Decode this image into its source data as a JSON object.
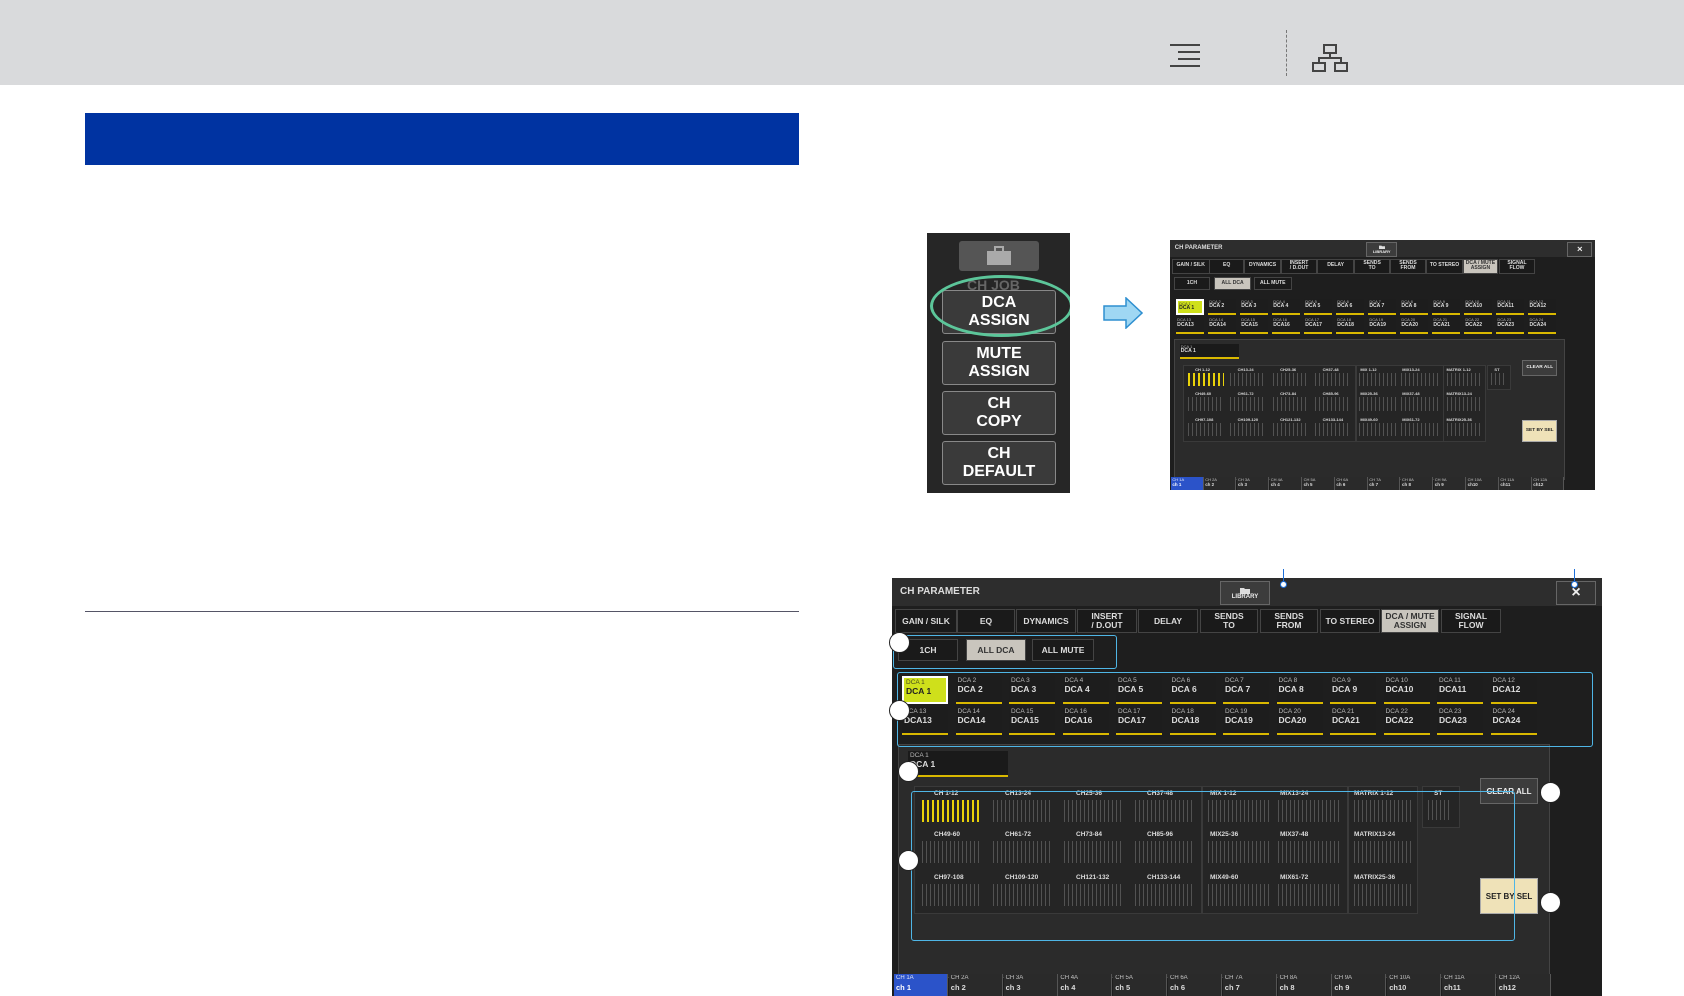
{
  "thumb_buttons": [
    {
      "label": "DCA\nASSIGN"
    },
    {
      "label": "MUTE\nASSIGN"
    },
    {
      "label": "CH\nCOPY"
    },
    {
      "label": "CH\nDEFAULT"
    }
  ],
  "thumb_header": "CH JOB",
  "screen": {
    "title": "CH PARAMETER",
    "library": "LIBRARY",
    "close": "×",
    "tabs": [
      "GAIN / SILK",
      "EQ",
      "DYNAMICS",
      "INSERT\n/ D.OUT",
      "DELAY",
      "SENDS\nTO",
      "SENDS\nFROM",
      "TO STEREO",
      "DCA / MUTE\nASSIGN",
      "SIGNAL\nFLOW"
    ],
    "selected_tab": 8,
    "modes": [
      "1CH",
      "ALL DCA",
      "ALL MUTE"
    ],
    "selected_mode": 1,
    "dca_row1": [
      {
        "n": "DCA 1",
        "l": "DCA 1"
      },
      {
        "n": "DCA 2",
        "l": "DCA 2"
      },
      {
        "n": "DCA 3",
        "l": "DCA 3"
      },
      {
        "n": "DCA 4",
        "l": "DCA 4"
      },
      {
        "n": "DCA 5",
        "l": "DCA 5"
      },
      {
        "n": "DCA 6",
        "l": "DCA 6"
      },
      {
        "n": "DCA 7",
        "l": "DCA 7"
      },
      {
        "n": "DCA 8",
        "l": "DCA 8"
      },
      {
        "n": "DCA 9",
        "l": "DCA 9"
      },
      {
        "n": "DCA 10",
        "l": "DCA10"
      },
      {
        "n": "DCA 11",
        "l": "DCA11"
      },
      {
        "n": "DCA 12",
        "l": "DCA12"
      }
    ],
    "dca_row2": [
      {
        "n": "DCA 13",
        "l": "DCA13"
      },
      {
        "n": "DCA 14",
        "l": "DCA14"
      },
      {
        "n": "DCA 15",
        "l": "DCA15"
      },
      {
        "n": "DCA 16",
        "l": "DCA16"
      },
      {
        "n": "DCA 17",
        "l": "DCA17"
      },
      {
        "n": "DCA 18",
        "l": "DCA18"
      },
      {
        "n": "DCA 19",
        "l": "DCA19"
      },
      {
        "n": "DCA 20",
        "l": "DCA20"
      },
      {
        "n": "DCA 21",
        "l": "DCA21"
      },
      {
        "n": "DCA 22",
        "l": "DCA22"
      },
      {
        "n": "DCA 23",
        "l": "DCA23"
      },
      {
        "n": "DCA 24",
        "l": "DCA24"
      }
    ],
    "current_dca": {
      "n": "DCA 1",
      "l": "DCA 1"
    },
    "ch_groups": [
      "CH 1-12",
      "CH13-24",
      "CH25-36",
      "CH37-48",
      "CH49-60",
      "CH61-72",
      "CH73-84",
      "CH85-96",
      "CH97-108",
      "CH109-120",
      "CH121-132",
      "CH133-144"
    ],
    "mix_groups": [
      "MIX 1-12",
      "MIX13-24",
      "MIX25-36",
      "MIX37-48",
      "MIX49-60",
      "MIX61-72"
    ],
    "matrix_groups": [
      "MATRIX 1-12",
      "MATRIX13-24",
      "MATRIX25-36"
    ],
    "st_label": "ST",
    "clear_all": "CLEAR ALL",
    "set_by_sel": "SET BY SEL",
    "channels": [
      {
        "a": "CH 1A",
        "b": "ch 1"
      },
      {
        "a": "CH 2A",
        "b": "ch 2"
      },
      {
        "a": "CH 3A",
        "b": "ch 3"
      },
      {
        "a": "CH 4A",
        "b": "ch 4"
      },
      {
        "a": "CH 5A",
        "b": "ch 5"
      },
      {
        "a": "CH 6A",
        "b": "ch 6"
      },
      {
        "a": "CH 7A",
        "b": "ch 7"
      },
      {
        "a": "CH 8A",
        "b": "ch 8"
      },
      {
        "a": "CH 9A",
        "b": "ch 9"
      },
      {
        "a": "CH 10A",
        "b": "ch10"
      },
      {
        "a": "CH 11A",
        "b": "ch11"
      },
      {
        "a": "CH 12A",
        "b": "ch12"
      }
    ]
  },
  "colors": {
    "header_band": "#0033a1",
    "selected_dca": "#cfe01b",
    "callout": "#4fb6e6",
    "selected_channel": "#2b53c9"
  }
}
